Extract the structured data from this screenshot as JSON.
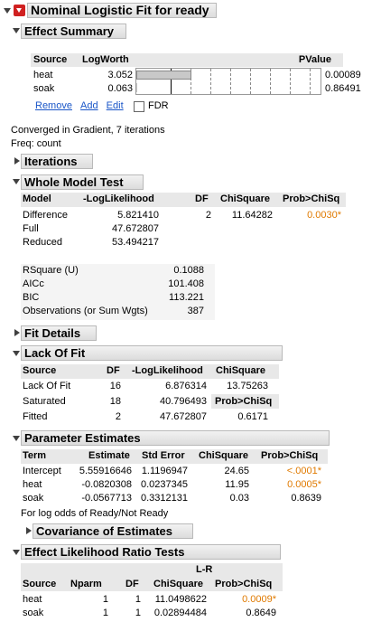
{
  "title": "Nominal Logistic Fit for ready",
  "effect_summary": {
    "header": "Effect Summary",
    "columns": [
      "Source",
      "LogWorth",
      "",
      "PValue"
    ],
    "rows": [
      {
        "source": "heat",
        "logworth": "3.052",
        "pvalue": "0.00089",
        "bar": 3.052
      },
      {
        "source": "soak",
        "logworth": "0.063",
        "pvalue": "0.86491",
        "bar": 0.063
      }
    ],
    "links": {
      "remove": "Remove",
      "add": "Add",
      "edit": "Edit"
    },
    "fdr_label": "FDR",
    "fdr_checked": false
  },
  "converged_text": "Converged in Gradient, 7 iterations",
  "freq_text": "Freq: count",
  "iterations_header": "Iterations",
  "whole_model": {
    "header": "Whole Model Test",
    "columns": [
      "Model",
      "-LogLikelihood",
      "DF",
      "ChiSquare",
      "Prob>ChiSq"
    ],
    "rows": [
      [
        "Difference",
        "5.821410",
        "2",
        "11.64282",
        "0.0030*"
      ],
      [
        "Full",
        "47.672807",
        "",
        "",
        ""
      ],
      [
        "Reduced",
        "53.494217",
        "",
        "",
        ""
      ]
    ],
    "stats": [
      [
        "RSquare (U)",
        "0.1088"
      ],
      [
        "AICc",
        "101.408"
      ],
      [
        "BIC",
        "113.221"
      ],
      [
        "Observations (or Sum Wgts)",
        "387"
      ]
    ]
  },
  "fit_details_header": "Fit Details",
  "lack_of_fit": {
    "header": "Lack Of Fit",
    "columns": [
      "Source",
      "DF",
      "-LogLikelihood",
      "ChiSquare"
    ],
    "rows": [
      [
        "Lack Of Fit",
        "16",
        "6.876314",
        "13.75263"
      ],
      [
        "Saturated",
        "18",
        "40.796493",
        "Prob>ChiSq"
      ],
      [
        "Fitted",
        "2",
        "47.672807",
        "0.6171"
      ]
    ]
  },
  "parameter_estimates": {
    "header": "Parameter Estimates",
    "columns": [
      "Term",
      "Estimate",
      "Std Error",
      "ChiSquare",
      "Prob>ChiSq"
    ],
    "rows": [
      [
        "Intercept",
        "5.55916646",
        "1.1196947",
        "24.65",
        "<.0001*"
      ],
      [
        "heat",
        "-0.0820308",
        "0.0237345",
        "11.95",
        "0.0005*"
      ],
      [
        "soak",
        "-0.0567713",
        "0.3312131",
        "0.03",
        "0.8639"
      ]
    ],
    "note": "For log odds of Ready/Not Ready"
  },
  "covariance_header": "Covariance of Estimates",
  "effect_lr": {
    "header": "Effect Likelihood Ratio Tests",
    "col_top": "L-R",
    "columns": [
      "Source",
      "Nparm",
      "DF",
      "ChiSquare",
      "Prob>ChiSq"
    ],
    "rows": [
      [
        "heat",
        "1",
        "1",
        "11.0498622",
        "0.0009*"
      ],
      [
        "soak",
        "1",
        "1",
        "0.02894484",
        "0.8649"
      ]
    ]
  },
  "colors": {
    "significant": "#e07a00",
    "link": "#1a56c8",
    "bar": "#c8c8c8"
  }
}
